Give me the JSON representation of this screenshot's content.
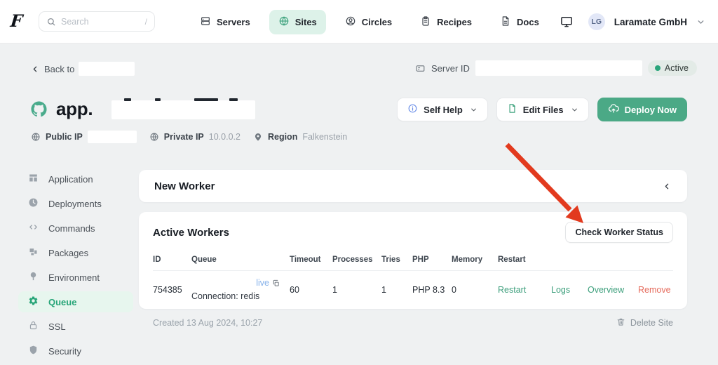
{
  "nav": {
    "logo": "F",
    "search": {
      "placeholder": "Search",
      "shortcut": "/"
    },
    "items": [
      {
        "label": "Servers",
        "icon": "servers-icon"
      },
      {
        "label": "Sites",
        "icon": "globe-icon",
        "active": true
      },
      {
        "label": "Circles",
        "icon": "user-circle-icon"
      },
      {
        "label": "Recipes",
        "icon": "clipboard-icon"
      },
      {
        "label": "Docs",
        "icon": "document-icon"
      }
    ],
    "account": {
      "initials": "LG",
      "name": "Laramate GmbH"
    }
  },
  "breadcrumb": {
    "back_label": "Back to"
  },
  "server": {
    "id_label": "Server ID",
    "status_badge": "Active"
  },
  "site": {
    "title_prefix": "app.",
    "public_ip_label": "Public IP",
    "private_ip_label": "Private IP",
    "private_ip_value": "10.0.0.2",
    "region_label": "Region",
    "region_value": "Falkenstein"
  },
  "actions": {
    "self_help": "Self Help",
    "edit_files": "Edit Files",
    "deploy_now": "Deploy Now"
  },
  "sidebar": {
    "items": [
      {
        "label": "Application",
        "icon": "application-icon"
      },
      {
        "label": "Deployments",
        "icon": "clock-icon"
      },
      {
        "label": "Commands",
        "icon": "code-icon"
      },
      {
        "label": "Packages",
        "icon": "package-icon"
      },
      {
        "label": "Environment",
        "icon": "tree-icon"
      },
      {
        "label": "Queue",
        "icon": "gear-icon",
        "active": true
      },
      {
        "label": "SSL",
        "icon": "lock-icon"
      },
      {
        "label": "Security",
        "icon": "shield-icon"
      }
    ]
  },
  "new_worker": {
    "title": "New Worker"
  },
  "active_workers": {
    "title": "Active Workers",
    "check_button": "Check Worker Status",
    "table": {
      "headers": [
        "ID",
        "Queue",
        "Timeout",
        "Processes",
        "Tries",
        "PHP",
        "Memory",
        "Restart"
      ],
      "row": {
        "id": "754385",
        "queue_name": "live",
        "connection": "Connection: redis",
        "timeout": "60",
        "processes": "1",
        "tries": "1",
        "php": "PHP 8.3",
        "memory": "0",
        "actions": {
          "restart": "Restart",
          "logs": "Logs",
          "overview": "Overview",
          "remove": "Remove"
        }
      }
    }
  },
  "footer": {
    "created": "Created 13 Aug 2024, 10:27",
    "delete_site": "Delete Site"
  },
  "colors": {
    "accent_green": "#3fa37e",
    "deploy_green": "#4ba986",
    "active_tab_bg": "#ddf2e9",
    "queue_active_bg": "#e7f6ee",
    "arrow_red": "#e23a1e",
    "remove_red": "#e5695a",
    "live_blue": "#85b1ea",
    "status_dot_green": "#2aa57b"
  }
}
